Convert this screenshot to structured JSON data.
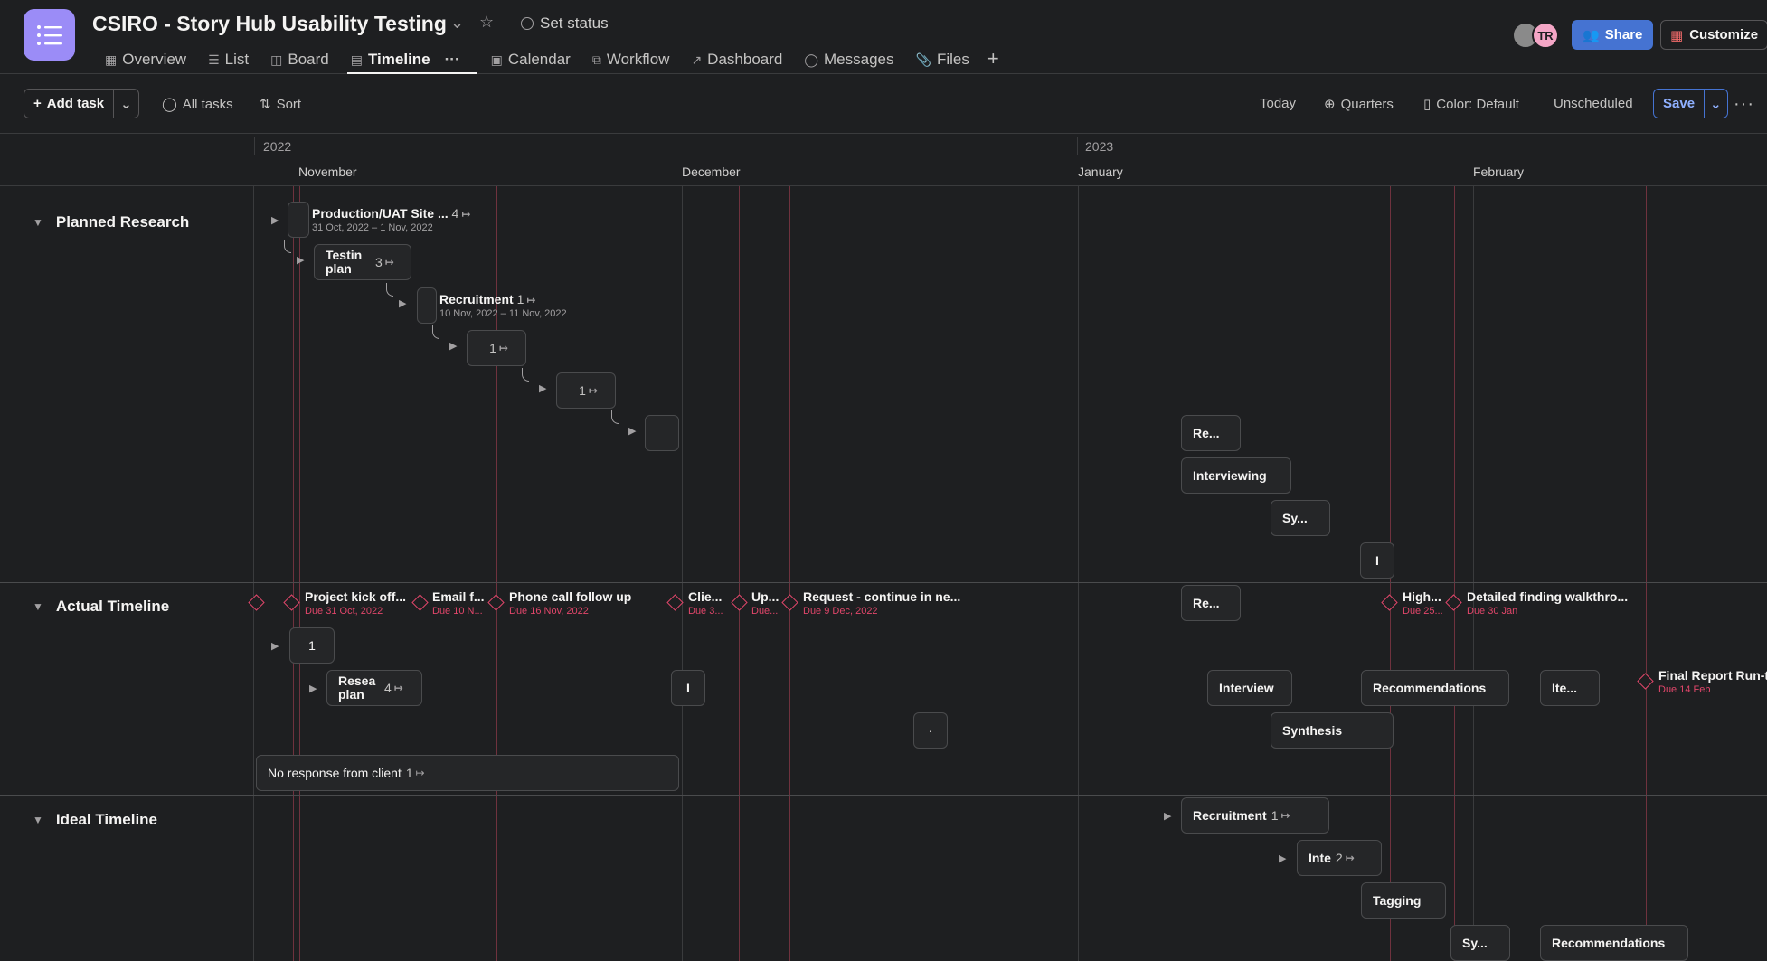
{
  "header": {
    "title": "CSIRO - Story Hub Usability Testing",
    "set_status": "Set status",
    "tabs": [
      {
        "label": "Overview",
        "icon": "overview-icon"
      },
      {
        "label": "List",
        "icon": "list-icon"
      },
      {
        "label": "Board",
        "icon": "board-icon"
      },
      {
        "label": "Timeline",
        "icon": "timeline-icon"
      },
      {
        "label": "Calendar",
        "icon": "calendar-icon"
      },
      {
        "label": "Workflow",
        "icon": "workflow-icon"
      },
      {
        "label": "Dashboard",
        "icon": "dashboard-icon"
      },
      {
        "label": "Messages",
        "icon": "messages-icon"
      },
      {
        "label": "Files",
        "icon": "files-icon"
      }
    ],
    "avatar_initials": "TR",
    "share_label": "Share",
    "customize_label": "Customize"
  },
  "toolbar": {
    "add_task": "Add task",
    "all_tasks": "All tasks",
    "sort": "Sort",
    "today": "Today",
    "quarters": "Quarters",
    "color": "Color: Default",
    "unscheduled": "Unscheduled",
    "save": "Save"
  },
  "timeline": {
    "years": [
      "2022",
      "2023"
    ],
    "months": [
      "November",
      "December",
      "January",
      "February"
    ],
    "sections": [
      "Planned Research",
      "Actual Timeline",
      "Ideal Timeline"
    ]
  },
  "planned": {
    "production": {
      "label": "Production/UAT Site ...",
      "count": "4",
      "dates": "31 Oct, 2022 – 1 Nov, 2022"
    },
    "testing_plan": {
      "label": "Testin plan",
      "count": "3"
    },
    "recruitment": {
      "label": "Recruitment",
      "count": "1",
      "dates": "10 Nov, 2022 – 11 Nov, 2022"
    },
    "sub1": {
      "count": "1"
    },
    "sub2": {
      "count": "1"
    },
    "re": "Re...",
    "interviewing": "Interviewing",
    "sy": "Sy...",
    "i": "I"
  },
  "actual": {
    "milestones": [
      {
        "label": "Project kick off...",
        "due": "Due 31 Oct, 2022"
      },
      {
        "label": "Email f...",
        "due": "Due 10 N..."
      },
      {
        "label": "Phone call follow up",
        "due": "Due 16 Nov, 2022"
      },
      {
        "label": "Clie...",
        "due": "Due 3..."
      },
      {
        "label": "Up...",
        "due": "Due..."
      },
      {
        "label": "Request - continue in ne...",
        "due": "Due 9 Dec, 2022"
      },
      {
        "label": "High...",
        "due": "Due 25..."
      },
      {
        "label": "Detailed finding walkthro...",
        "due": "Due 30 Jan"
      },
      {
        "label": "Final Report Run-t",
        "due": "Due 14 Feb"
      }
    ],
    "re": "Re...",
    "one": "1",
    "research_plan": {
      "label": "Resea plan",
      "count": "4"
    },
    "i": "I",
    "interview": "Interview",
    "recommendations": "Recommendations",
    "ite": "Ite...",
    "synthesis": "Synthesis",
    "dot": "·",
    "no_response": {
      "label": "No response from client",
      "count": "1"
    }
  },
  "ideal": {
    "recruitment": {
      "label": "Recruitment",
      "count": "1"
    },
    "inter": {
      "label": "Inte",
      "count": "2"
    },
    "tagging": "Tagging",
    "sy": "Sy...",
    "recommendations": "Recommendations"
  },
  "colors": {
    "background": "#1e1f21",
    "accent_blue": "#4573d2",
    "logo_purple": "#9b8cf7",
    "milestone_red": "#e0466a"
  }
}
